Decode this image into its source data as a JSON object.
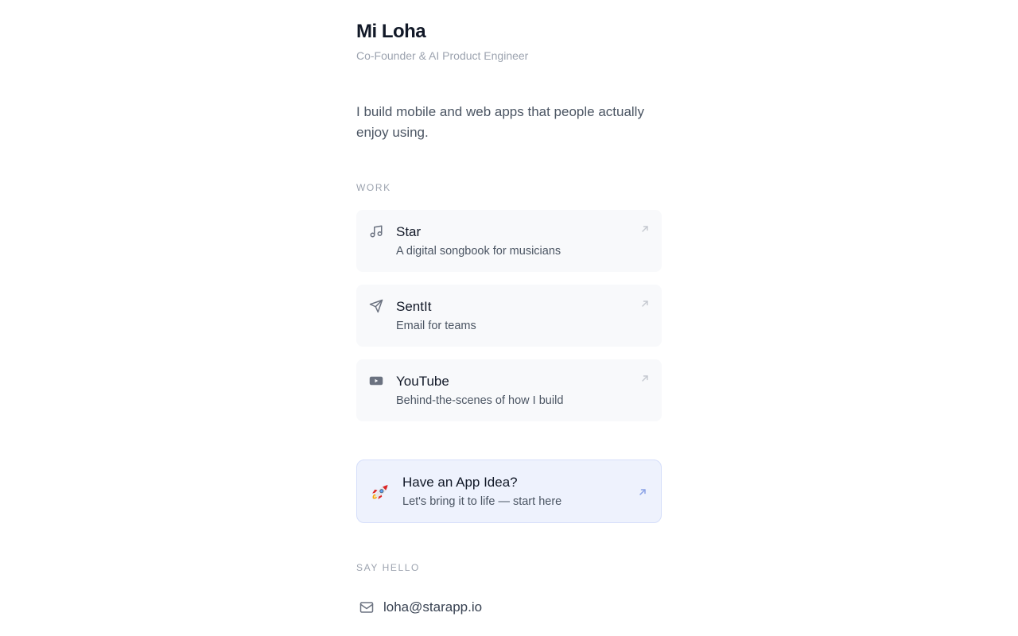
{
  "profile": {
    "name": "Mi Loha",
    "role": "Co-Founder & AI Product Engineer",
    "bio": "I build mobile and web apps that people actually enjoy using."
  },
  "work": {
    "label": "WORK",
    "items": [
      {
        "icon": "music-note-icon",
        "title": "Star",
        "description": "A digital songbook for musicians"
      },
      {
        "icon": "send-icon",
        "title": "SentIt",
        "description": "Email for teams"
      },
      {
        "icon": "youtube-icon",
        "title": "YouTube",
        "description": "Behind-the-scenes of how I build"
      }
    ]
  },
  "cta": {
    "icon": "rocket-icon",
    "title": "Have an App Idea?",
    "description": "Let's bring it to life — start here",
    "accent": "#eef2fd"
  },
  "contact": {
    "label": "SAY HELLO",
    "icon": "mail-icon",
    "email": "loha@starapp.io"
  }
}
